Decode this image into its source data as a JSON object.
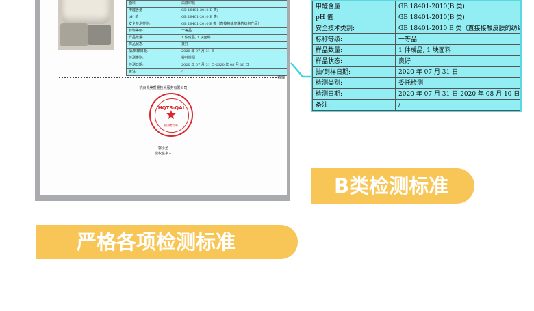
{
  "report": {
    "rows": [
      {
        "label": "面料",
        "value": "白底印花",
        "result": ""
      },
      {
        "label": "甲醛含量",
        "value": "GB 18401-2010(B 类)",
        "result": "符合"
      },
      {
        "label": "pH 值",
        "value": "GB 18401-2010(B 类)",
        "result": "符合"
      },
      {
        "label": "安全技术类别:",
        "value": "GB 18401-2010 B 类（直接接触皮肤的纺织产品）",
        "result": ""
      },
      {
        "label": "标称等级:",
        "value": "一等品",
        "result": ""
      },
      {
        "label": "样品数量:",
        "value": "1 件成品, 1 块面料",
        "result": ""
      },
      {
        "label": "样品状态:",
        "value": "良好",
        "result": ""
      },
      {
        "label": "抽/到样日期:",
        "value": "2020 年 07 月 31 日",
        "result": ""
      },
      {
        "label": "检测类别:",
        "value": "委托检测",
        "result": ""
      },
      {
        "label": "检测日期:",
        "value": "2020 年 07 月 31 日-2020 年 08 月 10 日",
        "result": ""
      },
      {
        "label": "备注:",
        "value": "/",
        "result": ""
      }
    ],
    "tail_text": "待续",
    "company": "杭州凯美质量技术服务有限公司",
    "seal_code": "HQTS-QAI",
    "seal_sub": "检测专用章",
    "signer": "郭小圣",
    "signer_role": "授权签字人"
  },
  "zoom": {
    "rows": [
      {
        "label": "甲醛含量",
        "value": "GB 18401-2010(B 类)"
      },
      {
        "label": "pH 值",
        "value": "GB 18401-2010(B 类)"
      },
      {
        "label": "安全技术类别:",
        "value": "GB 18401-2010 B 类（直接接触皮肤的纺织"
      },
      {
        "label": "标称等级:",
        "value": "一等品"
      },
      {
        "label": "样品数量:",
        "value": "1 件成品, 1 块面料"
      },
      {
        "label": "样品状态:",
        "value": "良好"
      },
      {
        "label": "抽/到样日期:",
        "value": "2020 年 07 月 31 日"
      },
      {
        "label": "检测类别:",
        "value": "委托检测"
      },
      {
        "label": "检测日期:",
        "value": "2020 年 07 月 31 日-2020 年 08 月 10 日"
      },
      {
        "label": "备注:",
        "value": "/"
      }
    ]
  },
  "banners": {
    "b_class": "B类检测标准",
    "main": "严格各项检测标准"
  },
  "colors": {
    "banner": "#f8c657",
    "table_fill": "#93eef4",
    "seal": "#d8292e",
    "connector": "#3fd3df"
  }
}
